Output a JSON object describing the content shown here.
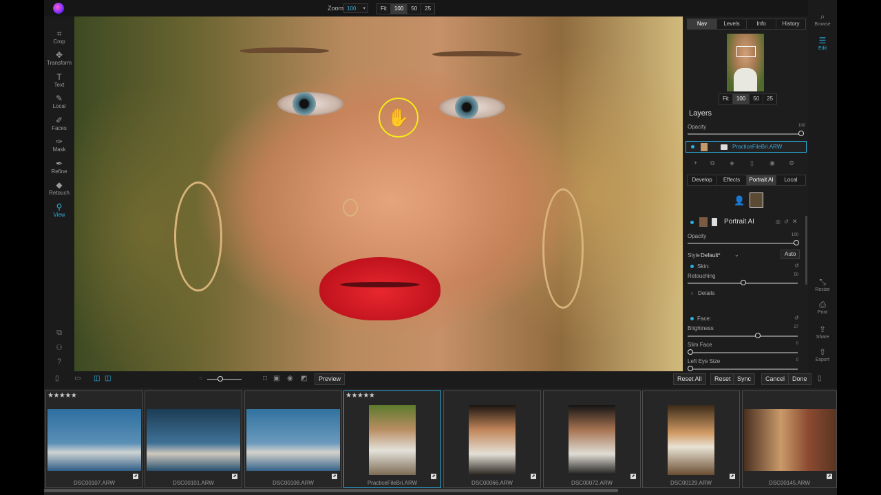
{
  "app": {
    "zoom_label": "Zoom",
    "zoom_value": "100",
    "zoom_presets": [
      "Fit",
      "100",
      "50",
      "25"
    ]
  },
  "left_tools": [
    {
      "label": "Crop",
      "icon": "crop-icon",
      "glyph": "⌗"
    },
    {
      "label": "Transform",
      "icon": "transform-icon",
      "glyph": "✥"
    },
    {
      "label": "Text",
      "icon": "text-icon",
      "glyph": "T"
    },
    {
      "label": "Local",
      "icon": "brush-icon",
      "glyph": "✎"
    },
    {
      "label": "Faces",
      "icon": "faces-icon",
      "glyph": "✐"
    },
    {
      "label": "Mask",
      "icon": "mask-icon",
      "glyph": "✑"
    },
    {
      "label": "Refine",
      "icon": "refine-icon",
      "glyph": "✒"
    },
    {
      "label": "Retouch",
      "icon": "retouch-icon",
      "glyph": "◆"
    },
    {
      "label": "View",
      "icon": "view-icon",
      "glyph": "⚲",
      "active": true
    }
  ],
  "bottom_toolbar": {
    "preview": "Preview",
    "reset_all": "Reset All",
    "reset": "Reset",
    "sync": "Sync",
    "cancel": "Cancel",
    "done": "Done"
  },
  "filmstrip": [
    {
      "name": "DSC00107.ARW",
      "stars": "★★★★★",
      "selected": false
    },
    {
      "name": "DSC00101.ARW",
      "stars": "",
      "selected": false
    },
    {
      "name": "DSC00108.ARW",
      "stars": "",
      "selected": false
    },
    {
      "name": "PracticeFileBri.ARW",
      "stars": "★★★★★",
      "selected": true
    },
    {
      "name": "DSC00066.ARW",
      "stars": "",
      "selected": false
    },
    {
      "name": "DSC00072.ARW",
      "stars": "",
      "selected": false
    },
    {
      "name": "DSC00129.ARW",
      "stars": "",
      "selected": false
    },
    {
      "name": "DSC00145.ARW",
      "stars": "",
      "selected": false
    }
  ],
  "right_panel": {
    "tabs": [
      "Nav",
      "Levels",
      "Info",
      "History"
    ],
    "nav_zoom_presets": [
      "Fit",
      "100",
      "50",
      "25"
    ],
    "layers_title": "Layers",
    "opacity_label": "Opacity",
    "opacity_value": "100",
    "layer_name": "PracticeFileBri.ARW",
    "module_tabs": [
      "Develop",
      "Effects",
      "Portrait AI",
      "Local"
    ],
    "module_title": "Portrait AI",
    "module_opacity_label": "Opacity",
    "module_opacity_value": "100",
    "style_label": "Style",
    "style_value": "Default*",
    "auto": "Auto",
    "skin_label": "Skin:",
    "retouching_label": "Retouching",
    "retouching_value": "50",
    "details_label": "Details",
    "face_label": "Face:",
    "brightness_label": "Brightness",
    "brightness_value": "27",
    "slim_face_label": "Slim Face",
    "slim_face_value": "0",
    "left_eye_label": "Left Eye Size",
    "left_eye_value": "0"
  },
  "far_right": [
    {
      "label": "Browse",
      "icon": "browse-icon",
      "glyph": "⌕"
    },
    {
      "label": "Edit",
      "icon": "edit-sliders-icon",
      "glyph": "☰",
      "active": true
    },
    {
      "label": "Resize",
      "icon": "resize-icon",
      "glyph": "⤡"
    },
    {
      "label": "Print",
      "icon": "print-icon",
      "glyph": "⎙"
    },
    {
      "label": "Share",
      "icon": "share-icon",
      "glyph": "⇪"
    },
    {
      "label": "Export",
      "icon": "export-icon",
      "glyph": "⇧"
    }
  ],
  "colors": {
    "accent": "#2bb0e0",
    "cursor_ring": "#f4ee16"
  }
}
